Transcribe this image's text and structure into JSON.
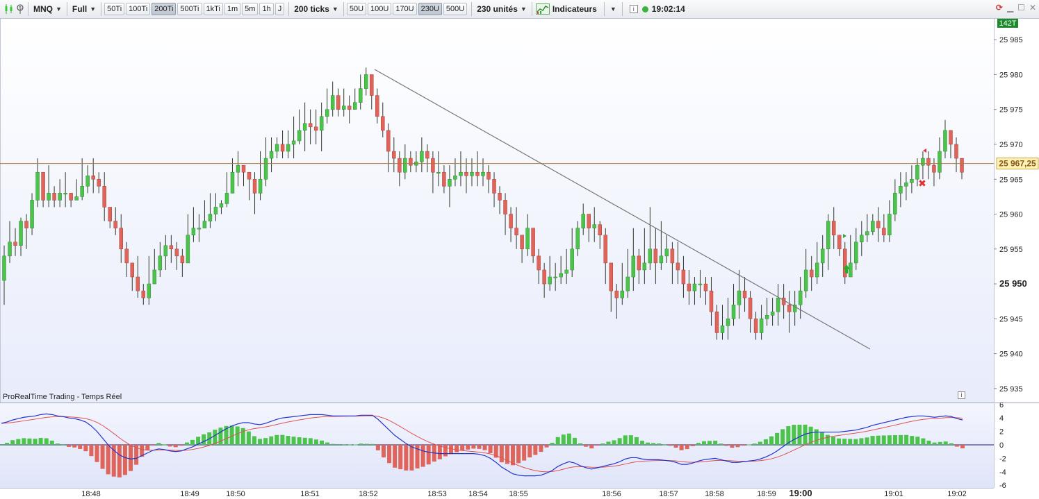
{
  "toolbar": {
    "instrument": "MNQ",
    "mode": "Full",
    "tick_buttons": [
      {
        "label": "50Ti",
        "active": false
      },
      {
        "label": "100Ti",
        "active": false
      },
      {
        "label": "200Ti",
        "active": true
      },
      {
        "label": "500Ti",
        "active": false
      },
      {
        "label": "1kTi",
        "active": false
      },
      {
        "label": "1m",
        "active": false
      },
      {
        "label": "5m",
        "active": false
      },
      {
        "label": "1h",
        "active": false
      },
      {
        "label": "J",
        "active": false
      }
    ],
    "ticks_dropdown": "200 ticks",
    "unit_buttons": [
      {
        "label": "50U",
        "active": false
      },
      {
        "label": "100U",
        "active": false
      },
      {
        "label": "170U",
        "active": false
      },
      {
        "label": "230U",
        "active": true
      },
      {
        "label": "500U",
        "active": false
      }
    ],
    "units_dropdown": "230 unités",
    "indicators_label": "Indicateurs",
    "clock": "19:02:14",
    "status_color": "#3bb33b"
  },
  "main": {
    "corner_badge": "142T",
    "price_labels": [
      "25 985",
      "25 980",
      "25 975",
      "25 970",
      "25 965",
      "25 960",
      "25 955",
      "25 950",
      "25 945",
      "25 940",
      "25 935"
    ],
    "current_price": "25 967,25",
    "footer_label": "ProRealTime Trading - Temps Réel"
  },
  "indicator": {
    "labels": [
      "6",
      "4",
      "2",
      "0",
      "-2",
      "-4",
      "-6"
    ]
  },
  "time_axis": {
    "labels": [
      {
        "label": "18:48",
        "bold": false
      },
      {
        "label": "18:49",
        "bold": false
      },
      {
        "label": "18:50",
        "bold": false
      },
      {
        "label": "18:51",
        "bold": false
      },
      {
        "label": "18:52",
        "bold": false
      },
      {
        "label": "18:53",
        "bold": false
      },
      {
        "label": "18:54",
        "bold": false
      },
      {
        "label": "18:55",
        "bold": false
      },
      {
        "label": "18:56",
        "bold": false
      },
      {
        "label": "18:57",
        "bold": false
      },
      {
        "label": "18:58",
        "bold": false
      },
      {
        "label": "18:59",
        "bold": false
      },
      {
        "label": "19:00",
        "bold": true
      },
      {
        "label": "19:01",
        "bold": false
      },
      {
        "label": "19:02",
        "bold": false
      }
    ]
  },
  "colors": {
    "bull": "#4cc44c",
    "bear": "#e0645a",
    "macd_line": "#2233cc",
    "signal_line": "#e05050",
    "price_line": "#b07a3a",
    "trend_line": "#777777"
  },
  "chart_data": {
    "type": "candlestick",
    "y_range": [
      25933,
      25988
    ],
    "candles": [
      [
        25950.5,
        25954,
        25955.5,
        25947
      ],
      [
        25954,
        25956,
        25959,
        25953
      ],
      [
        25956,
        25955.5,
        25958,
        25954
      ],
      [
        25955.5,
        25959,
        25959.5,
        25954
      ],
      [
        25959,
        25958,
        25960,
        25955
      ],
      [
        25958,
        25962,
        25963,
        25957
      ],
      [
        25962,
        25966,
        25968,
        25961
      ],
      [
        25966,
        25962,
        25963,
        25961
      ],
      [
        25962,
        25963,
        25967,
        25961
      ],
      [
        25963,
        25962,
        25964,
        25961
      ],
      [
        25962,
        25963,
        25965,
        25961
      ],
      [
        25963,
        25963,
        25966,
        25961
      ],
      [
        25963,
        25962,
        25963,
        25961
      ],
      [
        25962,
        25962.5,
        25965,
        25962
      ],
      [
        25962.5,
        25964,
        25968,
        25962
      ],
      [
        25964,
        25965.5,
        25967,
        25963
      ],
      [
        25965.5,
        25965,
        25968,
        25963
      ],
      [
        25965,
        25964,
        25966,
        25963
      ],
      [
        25964,
        25961,
        25966,
        25959
      ],
      [
        25961,
        25959,
        25961,
        25958
      ],
      [
        25959,
        25958,
        25961,
        25957
      ],
      [
        25958,
        25955,
        25960,
        25953
      ],
      [
        25955,
        25953,
        25956,
        25951
      ],
      [
        25953,
        25951,
        25953,
        25949
      ],
      [
        25951,
        25949,
        25954,
        25948
      ],
      [
        25949,
        25948,
        25950,
        25947
      ],
      [
        25948,
        25950,
        25954,
        25947
      ],
      [
        25950,
        25952,
        25955,
        25950
      ],
      [
        25952,
        25954,
        25956,
        25951
      ],
      [
        25954,
        25955.5,
        25957,
        25952
      ],
      [
        25955.5,
        25955,
        25957,
        25953
      ],
      [
        25955,
        25954,
        25956,
        25952
      ],
      [
        25954,
        25953,
        25955,
        25951
      ],
      [
        25953,
        25957,
        25960,
        25953
      ],
      [
        25957,
        25958,
        25961,
        25956
      ],
      [
        25958,
        25958,
        25960,
        25956
      ],
      [
        25958,
        25959,
        25962,
        25958
      ],
      [
        25959,
        25960,
        25963,
        25958
      ],
      [
        25960,
        25961,
        25963,
        25959
      ],
      [
        25961,
        25961.5,
        25962,
        25960
      ],
      [
        25961.5,
        25963,
        25966,
        25961
      ],
      [
        25963,
        25966,
        25968,
        25963
      ],
      [
        25966,
        25967,
        25969,
        25964
      ],
      [
        25967,
        25966,
        25967,
        25964
      ],
      [
        25966,
        25965,
        25966,
        25962
      ],
      [
        25965,
        25963,
        25966,
        25960
      ],
      [
        25963,
        25965,
        25969,
        25962
      ],
      [
        25965,
        25968,
        25971,
        25964
      ],
      [
        25968,
        25969,
        25971,
        25966
      ],
      [
        25969,
        25970,
        25971,
        25968
      ],
      [
        25970,
        25969,
        25972,
        25968
      ],
      [
        25969,
        25970,
        25972,
        25968
      ],
      [
        25970,
        25970.5,
        25974,
        25968
      ],
      [
        25970.5,
        25972,
        25975,
        25970
      ],
      [
        25972,
        25973,
        25976,
        25969
      ],
      [
        25973,
        25972.5,
        25975,
        25970
      ],
      [
        25972.5,
        25972,
        25975,
        25970
      ],
      [
        25972,
        25974,
        25976,
        25969
      ],
      [
        25974,
        25975,
        25978,
        25973
      ],
      [
        25975,
        25977,
        25979,
        25974
      ],
      [
        25977,
        25975,
        25978,
        25974
      ],
      [
        25975,
        25975.5,
        25978,
        25974
      ],
      [
        25975.5,
        25975,
        25977,
        25973
      ],
      [
        25975,
        25976,
        25978,
        25975
      ],
      [
        25976,
        25978,
        25980,
        25975
      ],
      [
        25978,
        25980,
        25981,
        25977
      ],
      [
        25980,
        25977,
        25980,
        25975
      ],
      [
        25977,
        25974,
        25978,
        25973
      ],
      [
        25974,
        25972,
        25976,
        25971
      ],
      [
        25972,
        25969,
        25973,
        25966
      ],
      [
        25969,
        25968,
        25971,
        25966
      ],
      [
        25968,
        25966,
        25969,
        25964
      ],
      [
        25966,
        25968,
        25970,
        25965
      ],
      [
        25968,
        25967,
        25969,
        25966
      ],
      [
        25967,
        25967.5,
        25969,
        25966
      ],
      [
        25967.5,
        25969,
        25971,
        25966
      ],
      [
        25969,
        25968,
        25970,
        25966
      ],
      [
        25968,
        25966,
        25969,
        25963
      ],
      [
        25966,
        25966,
        25969,
        25964
      ],
      [
        25966,
        25964,
        25967,
        25963
      ],
      [
        25964,
        25965,
        25967,
        25961
      ],
      [
        25965,
        25965.5,
        25968,
        25964
      ],
      [
        25965.5,
        25966,
        25969,
        25964
      ],
      [
        25966,
        25965.5,
        25968,
        25963
      ],
      [
        25965.5,
        25966,
        25968,
        25964
      ],
      [
        25966,
        25965.5,
        25969,
        25964
      ],
      [
        25965.5,
        25966,
        25968,
        25964
      ],
      [
        25966,
        25965,
        25967,
        25963
      ],
      [
        25965,
        25963,
        25966,
        25961
      ],
      [
        25963,
        25962,
        25964,
        25960
      ],
      [
        25962,
        25960,
        25963,
        25957
      ],
      [
        25960,
        25958,
        25961,
        25956
      ],
      [
        25958,
        25957,
        25961,
        25955
      ],
      [
        25957,
        25955,
        25957,
        25953
      ],
      [
        25955,
        25958,
        25960,
        25954
      ],
      [
        25958,
        25954,
        25958,
        25953
      ],
      [
        25954,
        25952,
        25955,
        25950
      ],
      [
        25952,
        25950,
        25953,
        25948
      ],
      [
        25950,
        25951,
        25954,
        25949
      ],
      [
        25951,
        25951,
        25953,
        25949
      ],
      [
        25951,
        25951.5,
        25954,
        25950
      ],
      [
        25951.5,
        25952,
        25955,
        25950
      ],
      [
        25952,
        25955,
        25958,
        25951
      ],
      [
        25955,
        25958,
        25959,
        25954
      ],
      [
        25958,
        25960,
        25961.5,
        25957
      ],
      [
        25960,
        25958,
        25960,
        25956
      ],
      [
        25958,
        25958.5,
        25961,
        25956
      ],
      [
        25958.5,
        25957,
        25959,
        25955
      ],
      [
        25957,
        25953,
        25958,
        25950
      ],
      [
        25953,
        25949,
        25953,
        25946
      ],
      [
        25949,
        25948,
        25950,
        25945
      ],
      [
        25948,
        25949,
        25953,
        25947
      ],
      [
        25949,
        25951,
        25955,
        25948
      ],
      [
        25951,
        25954,
        25958,
        25949
      ],
      [
        25954,
        25952,
        25955,
        25950
      ],
      [
        25952,
        25953,
        25958,
        25950
      ],
      [
        25953,
        25955,
        25961,
        25952
      ],
      [
        25955,
        25953,
        25958,
        25950
      ],
      [
        25953,
        25954,
        25959,
        25952
      ],
      [
        25954,
        25955,
        25957,
        25953
      ],
      [
        25955,
        25953,
        25956,
        25950
      ],
      [
        25953,
        25952,
        25956,
        25950
      ],
      [
        25952,
        25950,
        25954,
        25948
      ],
      [
        25950,
        25949,
        25952,
        25947
      ],
      [
        25949,
        25950,
        25951,
        25947
      ],
      [
        25950,
        25950,
        25952,
        25948
      ],
      [
        25950,
        25949,
        25951,
        25947
      ],
      [
        25949,
        25946,
        25951,
        25944
      ],
      [
        25946,
        25943,
        25947,
        25942
      ],
      [
        25943,
        25944,
        25947,
        25942
      ],
      [
        25944,
        25945,
        25948,
        25942
      ],
      [
        25945,
        25947,
        25950,
        25944
      ],
      [
        25947,
        25949,
        25952,
        25945
      ],
      [
        25949,
        25948,
        25951,
        25946
      ],
      [
        25948,
        25945,
        25949,
        25943
      ],
      [
        25945,
        25943,
        25946,
        25942
      ],
      [
        25943,
        25945,
        25947,
        25942
      ],
      [
        25945,
        25945.5,
        25948,
        25944
      ],
      [
        25945.5,
        25946,
        25948,
        25944
      ],
      [
        25946,
        25948,
        25950,
        25944
      ],
      [
        25948,
        25947,
        25950,
        25945
      ],
      [
        25947,
        25946,
        25949,
        25943
      ],
      [
        25946,
        25947,
        25949,
        25944
      ],
      [
        25947,
        25949,
        25951,
        25945
      ],
      [
        25949,
        25952,
        25955,
        25948
      ],
      [
        25952,
        25951,
        25954,
        25949
      ],
      [
        25951,
        25953,
        25956,
        25950
      ],
      [
        25953,
        25955,
        25957,
        25951
      ],
      [
        25955,
        25959,
        25960,
        25952
      ],
      [
        25959,
        25957,
        25961,
        25955
      ],
      [
        25957,
        25955,
        25957,
        25954
      ],
      [
        25955,
        25951,
        25956,
        25950
      ],
      [
        25951,
        25953,
        25957,
        25951
      ],
      [
        25953,
        25956,
        25958,
        25952
      ],
      [
        25956,
        25957,
        25959,
        25954
      ],
      [
        25957,
        25957.5,
        25960,
        25956
      ],
      [
        25957.5,
        25959,
        25960,
        25957
      ],
      [
        25959,
        25958,
        25961,
        25956
      ],
      [
        25958,
        25957,
        25960,
        25956
      ],
      [
        25957,
        25960,
        25962,
        25956
      ],
      [
        25960,
        25963,
        25965,
        25959
      ],
      [
        25963,
        25964,
        25966,
        25961
      ],
      [
        25964,
        25964.5,
        25966,
        25962
      ],
      [
        25964.5,
        25965,
        25967,
        25963
      ],
      [
        25965,
        25967,
        25968,
        25964
      ],
      [
        25967,
        25968,
        25969,
        25965
      ],
      [
        25968,
        25967,
        25969,
        25965
      ],
      [
        25967,
        25966,
        25968,
        25964
      ],
      [
        25966,
        25969,
        25971,
        25965
      ],
      [
        25969,
        25972,
        25973.5,
        25968
      ],
      [
        25972,
        25970,
        25972,
        25968
      ],
      [
        25970,
        25968,
        25971,
        25966
      ],
      [
        25968,
        25966,
        25968,
        25965
      ]
    ],
    "macd": [
      3.2,
      3.4,
      3.7,
      3.9,
      4.1,
      4.2,
      4.3,
      4.5,
      4.6,
      4.5,
      4.3,
      4.2,
      4.0,
      3.9,
      3.7,
      3.4,
      2.8,
      2.0,
      1.0,
      0.0,
      -0.8,
      -1.5,
      -1.9,
      -2.1,
      -2.0,
      -1.6,
      -1.2,
      -0.8,
      -0.6,
      -0.7,
      -0.9,
      -1.0,
      -0.9,
      -0.6,
      -0.3,
      0.1,
      0.5,
      0.9,
      1.4,
      1.9,
      2.4,
      2.8,
      3.1,
      3.3,
      3.3,
      3.1,
      3.0,
      3.2,
      3.5,
      3.8,
      4.0,
      4.1,
      4.2,
      4.3,
      4.4,
      4.5,
      4.5,
      4.5,
      4.4,
      4.3,
      4.3,
      4.3,
      4.3,
      4.3,
      4.4,
      4.4,
      4.4,
      3.8,
      3.0,
      2.2,
      1.4,
      0.8,
      0.2,
      -0.3,
      -0.6,
      -0.9,
      -1.1,
      -1.2,
      -1.3,
      -1.3,
      -1.3,
      -1.3,
      -1.3,
      -1.3,
      -1.3,
      -1.4,
      -1.6,
      -2.0,
      -2.6,
      -3.3,
      -3.8,
      -4.3,
      -4.5,
      -4.6,
      -4.6,
      -4.6,
      -4.5,
      -4.2,
      -3.8,
      -3.2,
      -2.8,
      -2.5,
      -2.7,
      -3.1,
      -3.4,
      -3.6,
      -3.4,
      -3.2,
      -3.0,
      -2.8,
      -2.5,
      -2.1,
      -1.9,
      -1.9,
      -2.1,
      -2.2,
      -2.2,
      -2.2,
      -2.3,
      -2.4,
      -2.6,
      -2.9,
      -2.9,
      -2.7,
      -2.4,
      -2.2,
      -2.1,
      -2.0,
      -2.2,
      -2.4,
      -2.6,
      -2.6,
      -2.5,
      -2.4,
      -2.3,
      -2.1,
      -1.8,
      -1.4,
      -0.9,
      -0.3,
      0.3,
      0.8,
      1.2,
      1.6,
      1.8,
      1.9,
      1.9,
      1.9,
      1.9,
      1.9,
      2.0,
      2.1,
      2.2,
      2.4,
      2.6,
      2.9,
      3.1,
      3.3,
      3.5,
      3.7,
      3.9,
      4.1,
      4.2,
      4.3,
      4.3,
      4.2,
      4.1,
      4.2,
      4.3,
      4.2,
      3.9,
      3.7
    ]
  }
}
